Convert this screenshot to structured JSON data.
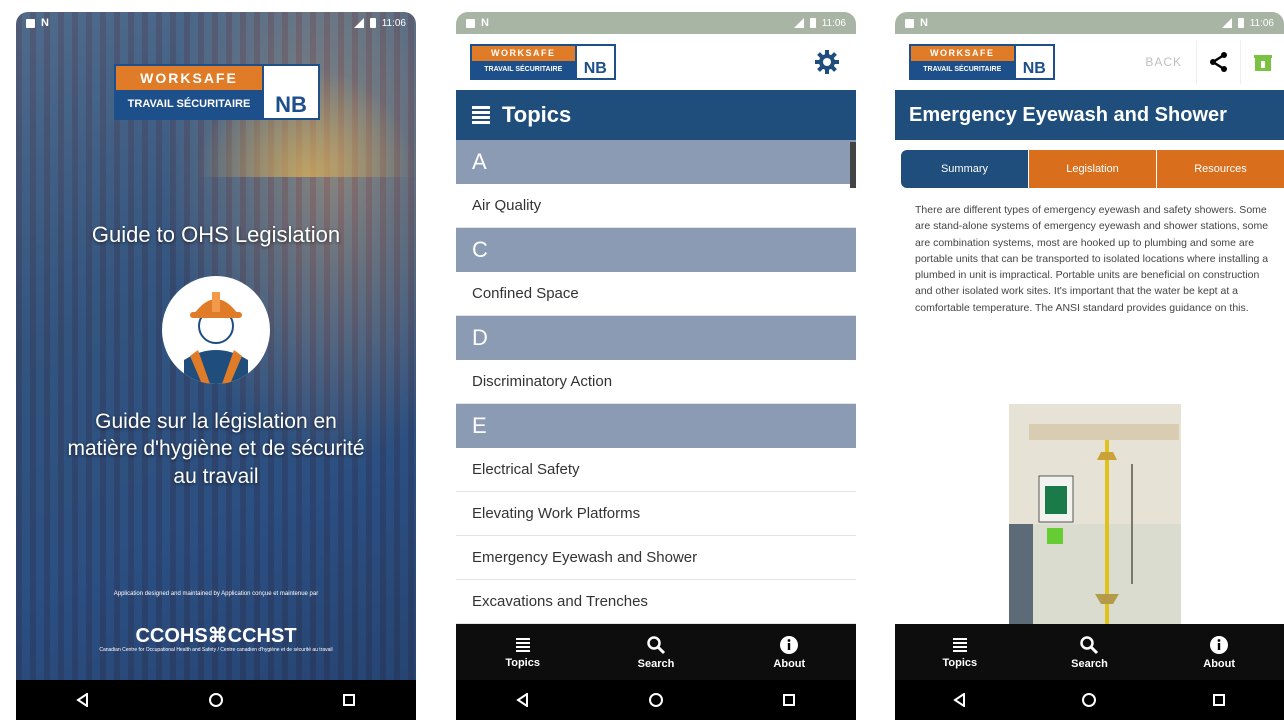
{
  "status": {
    "time": "11:06"
  },
  "logo": {
    "line1": "WORKSAFE",
    "line2": "TRAVAIL SÉCURITAIRE",
    "badge": "NB"
  },
  "splash": {
    "title_en": "Guide to OHS Legislation",
    "title_fr": "Guide sur la législation en matière d'hygiène et de sécurité au travail",
    "credit": "Application designed and maintained by Application conçue et maintenue par",
    "org_logo": "CCOHS⌘CCHST",
    "org_name": "Canadian Centre for Occupational Health and Safety / Centre canadien d'hygiène et de sécurité au travail"
  },
  "topics_screen": {
    "header": "Topics",
    "sections": [
      {
        "letter": "A",
        "items": [
          "Air Quality"
        ]
      },
      {
        "letter": "C",
        "items": [
          "Confined Space"
        ]
      },
      {
        "letter": "D",
        "items": [
          "Discriminatory Action"
        ]
      },
      {
        "letter": "E",
        "items": [
          "Electrical Safety",
          "Elevating Work Platforms",
          "Emergency Eyewash and Shower",
          "Excavations and Trenches"
        ]
      }
    ]
  },
  "tabs": [
    {
      "label": "Topics",
      "icon": "list-icon"
    },
    {
      "label": "Search",
      "icon": "search-icon"
    },
    {
      "label": "About",
      "icon": "info-icon"
    }
  ],
  "detail_screen": {
    "back": "BACK",
    "title": "Emergency Eyewash and Shower",
    "subtabs": [
      "Summary",
      "Legislation",
      "Resources"
    ],
    "summary": "There are different types of emergency eyewash and safety showers. Some are stand-alone systems of emergency eyewash and shower stations, some are combination systems, most are hooked up to plumbing and some are portable units that can be transported to isolated locations where installing a plumbed in unit is impractical. Portable units are beneficial on construction and other isolated work sites. It's important that the water be kept at a comfortable temperature. The ANSI standard provides guidance on this."
  },
  "colors": {
    "navy": "#1f4e7d",
    "orange": "#d96f1c",
    "section_gray": "#8a9bb3"
  }
}
